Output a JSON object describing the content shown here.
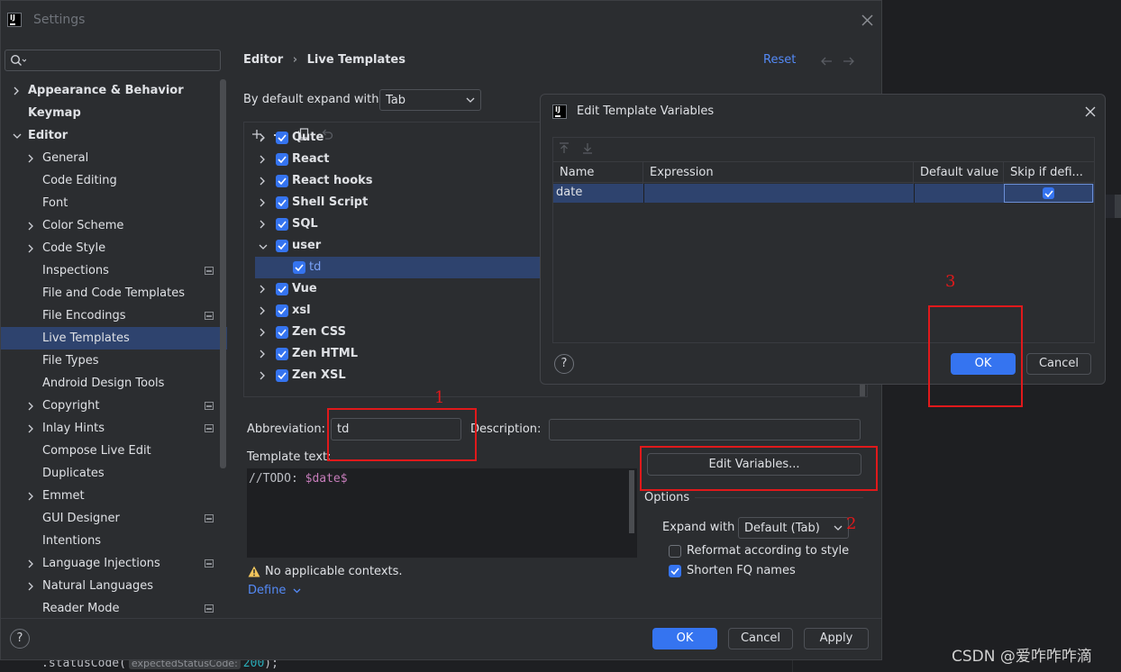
{
  "background_editor": {
    "code_line_prefix": ".statusCode(",
    "param_hint": "expectedStatusCode:",
    "code_value": "200",
    "code_suffix": ");"
  },
  "watermark": "CSDN @爱咋咋咋滴",
  "settings": {
    "title": "Settings",
    "app_icon_text": "IJ",
    "search_placeholder": "",
    "breadcrumb_parent": "Editor",
    "breadcrumb_sep": "›",
    "breadcrumb_current": "Live Templates",
    "reset_label": "Reset",
    "sidebar": [
      {
        "label": "Appearance & Behavior",
        "level": 0,
        "arrow": "right",
        "bold": true,
        "pin": false
      },
      {
        "label": "Keymap",
        "level": 0,
        "arrow": "none",
        "bold": true,
        "pin": false
      },
      {
        "label": "Editor",
        "level": 0,
        "arrow": "down",
        "bold": true,
        "pin": false
      },
      {
        "label": "General",
        "level": 1,
        "arrow": "right",
        "pin": false
      },
      {
        "label": "Code Editing",
        "level": 1,
        "arrow": "none",
        "pin": false
      },
      {
        "label": "Font",
        "level": 1,
        "arrow": "none",
        "pin": false
      },
      {
        "label": "Color Scheme",
        "level": 1,
        "arrow": "right",
        "pin": false
      },
      {
        "label": "Code Style",
        "level": 1,
        "arrow": "right",
        "pin": false
      },
      {
        "label": "Inspections",
        "level": 1,
        "arrow": "none",
        "pin": true
      },
      {
        "label": "File and Code Templates",
        "level": 1,
        "arrow": "none",
        "pin": false
      },
      {
        "label": "File Encodings",
        "level": 1,
        "arrow": "none",
        "pin": true
      },
      {
        "label": "Live Templates",
        "level": 1,
        "arrow": "none",
        "pin": false,
        "selected": true
      },
      {
        "label": "File Types",
        "level": 1,
        "arrow": "none",
        "pin": false
      },
      {
        "label": "Android Design Tools",
        "level": 1,
        "arrow": "none",
        "pin": false
      },
      {
        "label": "Copyright",
        "level": 1,
        "arrow": "right",
        "pin": true
      },
      {
        "label": "Inlay Hints",
        "level": 1,
        "arrow": "right",
        "pin": true
      },
      {
        "label": "Compose Live Edit",
        "level": 1,
        "arrow": "none",
        "pin": false
      },
      {
        "label": "Duplicates",
        "level": 1,
        "arrow": "none",
        "pin": false
      },
      {
        "label": "Emmet",
        "level": 1,
        "arrow": "right",
        "pin": false
      },
      {
        "label": "GUI Designer",
        "level": 1,
        "arrow": "none",
        "pin": true
      },
      {
        "label": "Intentions",
        "level": 1,
        "arrow": "none",
        "pin": false
      },
      {
        "label": "Language Injections",
        "level": 1,
        "arrow": "right",
        "pin": true
      },
      {
        "label": "Natural Languages",
        "level": 1,
        "arrow": "right",
        "pin": false
      },
      {
        "label": "Reader Mode",
        "level": 1,
        "arrow": "none",
        "pin": true
      }
    ],
    "expand_label": "By default expand with",
    "expand_value": "Tab",
    "template_groups": [
      {
        "label": "Qute",
        "arrow": "right",
        "checked": true,
        "bold": true
      },
      {
        "label": "React",
        "arrow": "right",
        "checked": true,
        "bold": true
      },
      {
        "label": "React hooks",
        "arrow": "right",
        "checked": true,
        "bold": true
      },
      {
        "label": "Shell Script",
        "arrow": "right",
        "checked": true,
        "bold": true
      },
      {
        "label": "SQL",
        "arrow": "right",
        "checked": true,
        "bold": true
      },
      {
        "label": "user",
        "arrow": "down",
        "checked": true,
        "bold": true
      },
      {
        "label": "td",
        "arrow": "none",
        "checked": true,
        "child": true,
        "selected": true
      },
      {
        "label": "Vue",
        "arrow": "right",
        "checked": true,
        "bold": true
      },
      {
        "label": "xsl",
        "arrow": "right",
        "checked": true,
        "bold": true
      },
      {
        "label": "Zen CSS",
        "arrow": "right",
        "checked": true,
        "bold": true
      },
      {
        "label": "Zen HTML",
        "arrow": "right",
        "checked": true,
        "bold": true
      },
      {
        "label": "Zen XSL",
        "arrow": "right",
        "checked": true,
        "bold": true
      }
    ],
    "abbreviation_label": "Abbreviation:",
    "abbreviation_value": "td",
    "description_label": "Description:",
    "description_value": "",
    "template_text_label": "Template text:",
    "template_text_prefix": "//TODO: ",
    "template_text_var": "$date$",
    "edit_variables_label": "Edit Variables...",
    "options_label": "Options",
    "expand_with_label": "Expand with",
    "expand_with_value": "Default (Tab)",
    "reformat_label": "Reformat according to style",
    "reformat_checked": false,
    "shorten_label": "Shorten FQ names",
    "shorten_checked": true,
    "warning_text": "No applicable contexts.",
    "define_label": "Define",
    "help_label": "?",
    "ok_label": "OK",
    "cancel_label": "Cancel",
    "apply_label": "Apply"
  },
  "dialog": {
    "title": "Edit Template Variables",
    "columns": [
      "Name",
      "Expression",
      "Default value",
      "Skip if defi..."
    ],
    "rows": [
      {
        "name": "date",
        "expression": "",
        "default_value": "",
        "skip_if_defined": true
      }
    ],
    "help_label": "?",
    "ok_label": "OK",
    "cancel_label": "Cancel"
  },
  "annotations": {
    "label_1": "1",
    "label_2": "2",
    "label_3": "3",
    "color": "#e0191b"
  },
  "colors": {
    "accent": "#3574f0",
    "selection": "#2e436e",
    "dialog_row_selection": "#2e436e",
    "variable": "#c77dbb"
  }
}
